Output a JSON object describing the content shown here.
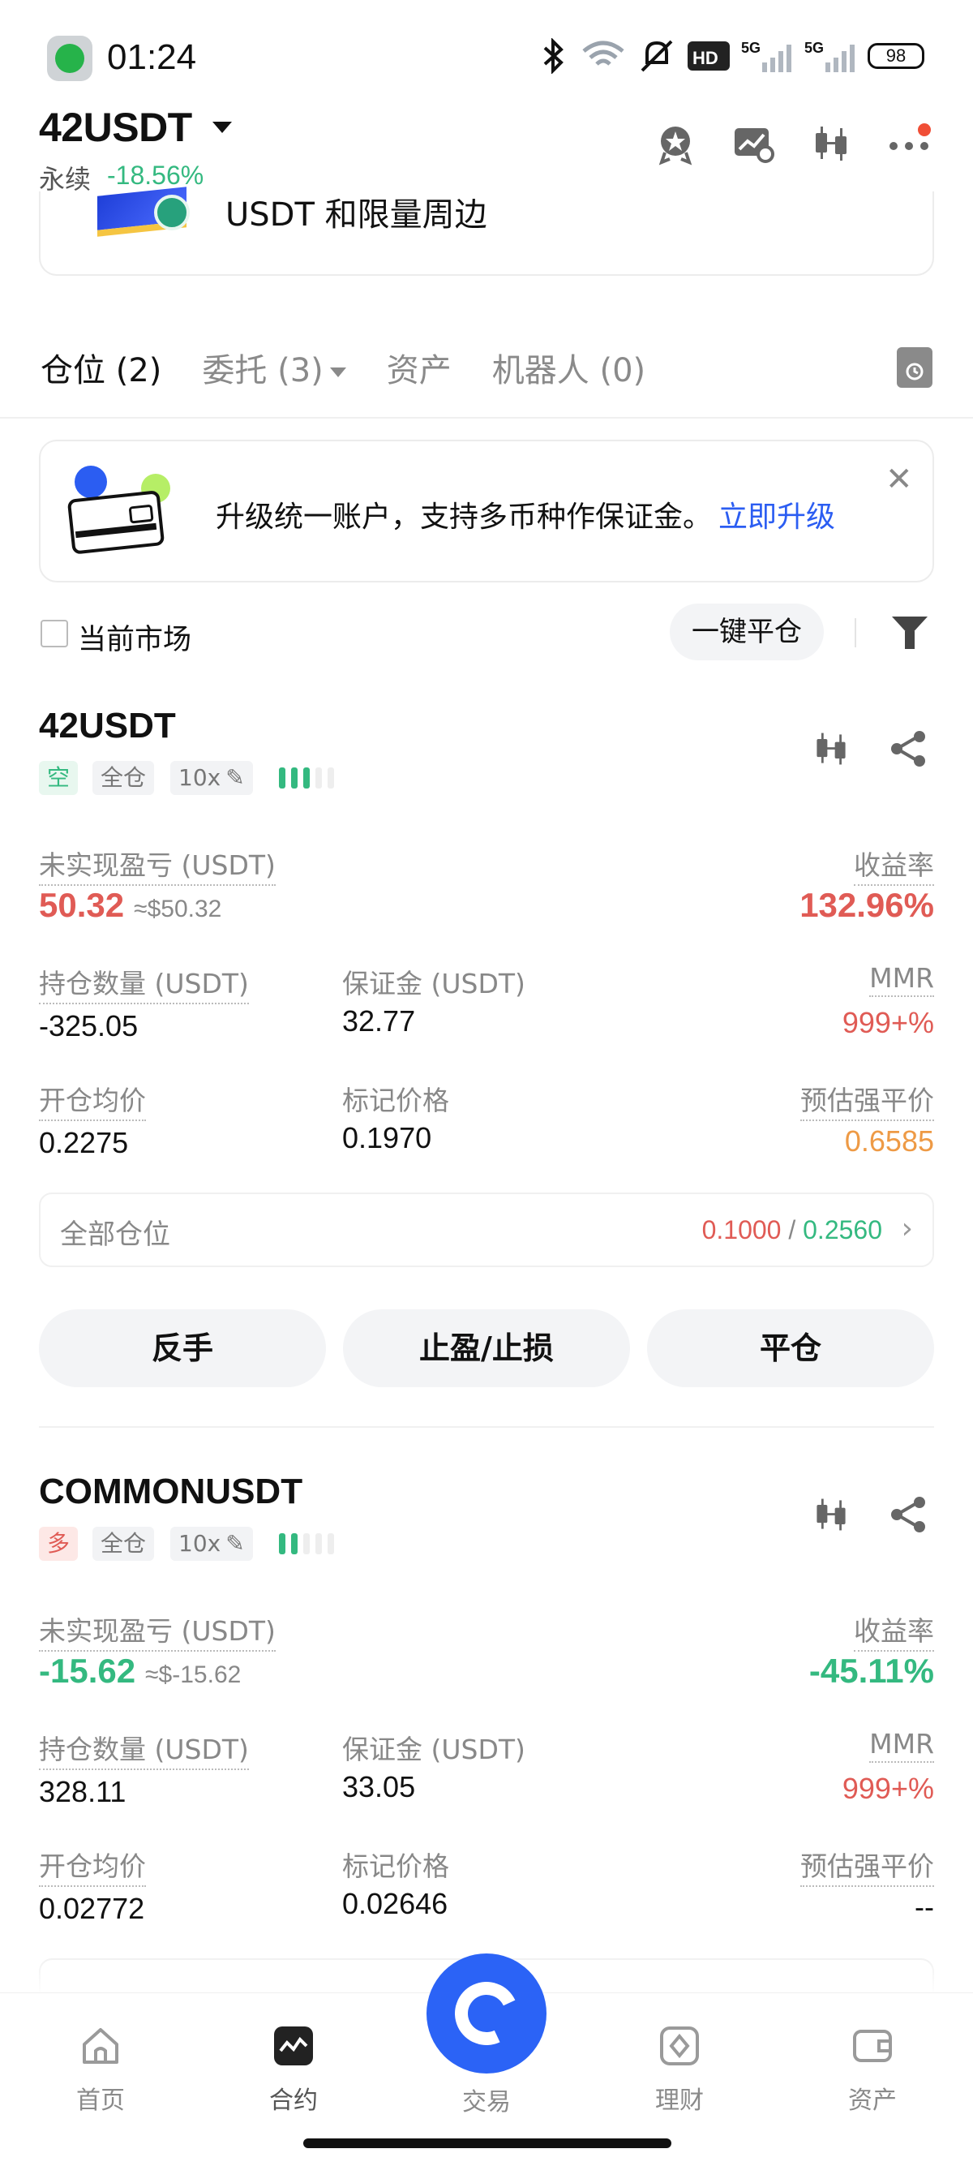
{
  "status_bar": {
    "time": "01:24",
    "battery": "98"
  },
  "header": {
    "pair": "42USDT",
    "contract_type": "永续",
    "change": "-18.56%"
  },
  "top_banner": {
    "text": "USDT 和限量周边"
  },
  "tabs": [
    {
      "label": "仓位 (2)"
    },
    {
      "label": "委托 (3)"
    },
    {
      "label": "资产"
    },
    {
      "label": "机器人 (0)"
    }
  ],
  "upgrade_banner": {
    "text": "升级统一账户，支持多币种作保证金。",
    "link": "立即升级"
  },
  "filter": {
    "current_market": "当前市场",
    "close_all": "一键平仓"
  },
  "positions": [
    {
      "symbol": "42USDT",
      "side": "空",
      "margin_mode": "全仓",
      "leverage": "10x",
      "risk_bars_filled": 3,
      "labels": {
        "upnl": "未实现盈亏 (USDT)",
        "roe": "收益率",
        "size": "持仓数量 (USDT)",
        "margin": "保证金 (USDT)",
        "mmr": "MMR",
        "entry": "开仓均价",
        "mark": "标记价格",
        "liq": "预估强平价"
      },
      "upnl": "50.32",
      "upnl_usd": "≈$50.32",
      "roe": "132.96%",
      "size": "-325.05",
      "margin": "32.77",
      "mmr": "999+%",
      "entry": "0.2275",
      "mark": "0.1970",
      "liq": "0.6585",
      "all_positions_label": "全部仓位",
      "tp": "0.1000",
      "sl": "0.2560",
      "actions": [
        "反手",
        "止盈/止损",
        "平仓"
      ]
    },
    {
      "symbol": "COMMONUSDT",
      "side": "多",
      "margin_mode": "全仓",
      "leverage": "10x",
      "risk_bars_filled": 2,
      "labels": {
        "upnl": "未实现盈亏 (USDT)",
        "roe": "收益率",
        "size": "持仓数量 (USDT)",
        "margin": "保证金 (USDT)",
        "mmr": "MMR",
        "entry": "开仓均价",
        "mark": "标记价格",
        "liq": "预估强平价"
      },
      "upnl": "-15.62",
      "upnl_usd": "≈$-15.62",
      "roe": "-45.11%",
      "size": "328.11",
      "margin": "33.05",
      "mmr": "999+%",
      "entry": "0.02772",
      "mark": "0.02646",
      "liq": "--"
    }
  ],
  "bottom_nav": [
    {
      "label": "首页"
    },
    {
      "label": "合约"
    },
    {
      "label": "交易"
    },
    {
      "label": "理财"
    },
    {
      "label": "资产"
    }
  ],
  "colors": {
    "accent": "#2b63f6",
    "up": "#34b980",
    "down": "#e05b55",
    "warn": "#ee9a45"
  }
}
